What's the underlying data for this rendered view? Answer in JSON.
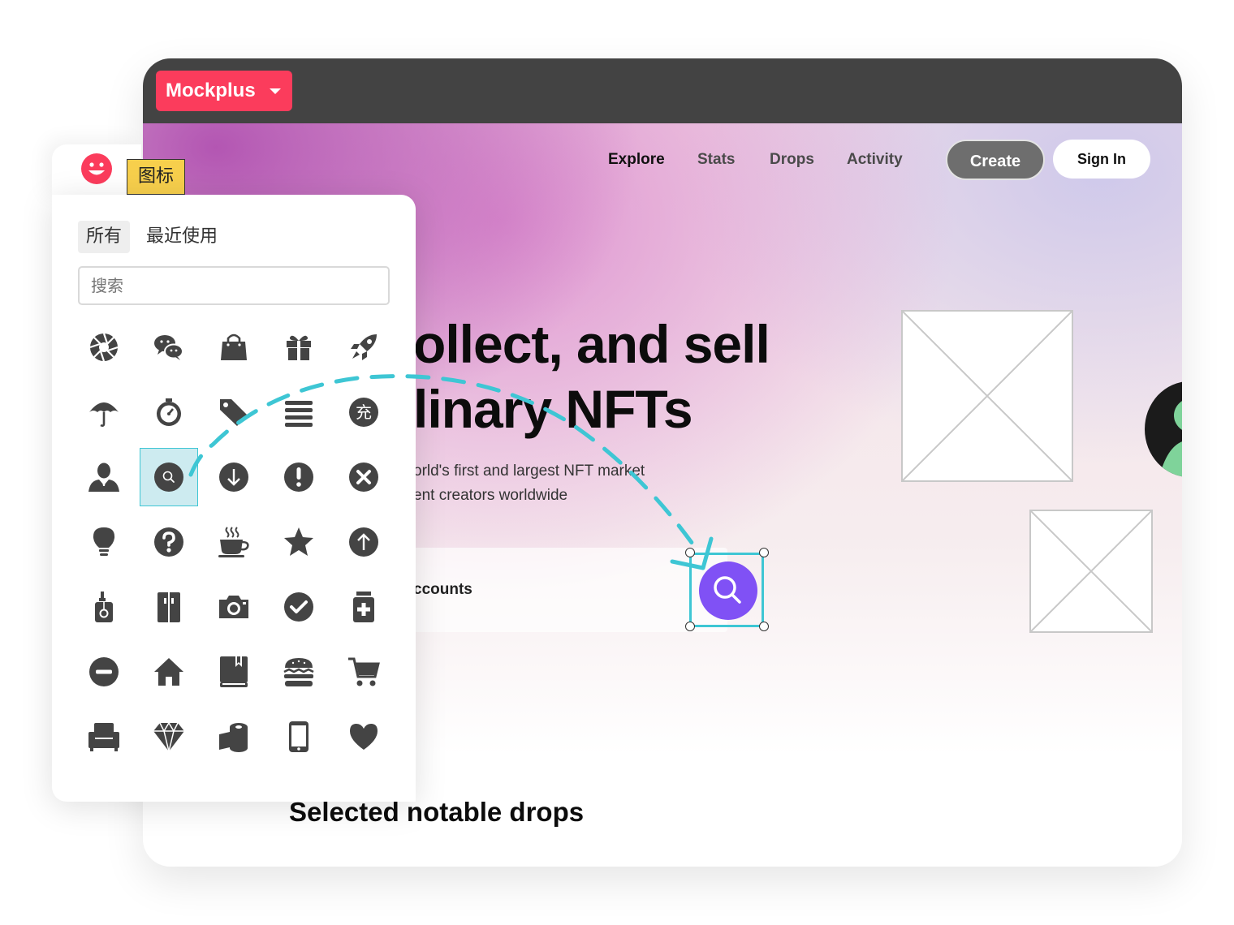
{
  "app": {
    "brand_label": "Mockplus"
  },
  "site": {
    "nav": [
      "Explore",
      "Stats",
      "Drops",
      "Activity"
    ],
    "create_label": "Create",
    "signin_label": "Sign In",
    "hero_title_line1": "ollect, and sell",
    "hero_title_line2": "linary NFTs",
    "hero_sub_line1": "orld's first and largest NFT market",
    "hero_sub_line2": "ent creators worldwide",
    "search_text": "ccounts",
    "section_title": "Selected notable drops"
  },
  "icon_panel": {
    "tag_label": "图标",
    "tabs": [
      "所有",
      "最近使用"
    ],
    "search_placeholder": "搜索",
    "charge_glyph": "充",
    "icons": [
      "aperture-icon",
      "wechat-icon",
      "shopping-bag-icon",
      "gift-icon",
      "rocket-icon",
      "umbrella-icon",
      "stopwatch-icon",
      "tag-icon",
      "list-icon",
      "charge-icon",
      "user-icon",
      "search-icon",
      "arrow-down-circle-icon",
      "exclamation-circle-icon",
      "close-circle-icon",
      "lightbulb-icon",
      "question-circle-icon",
      "coffee-icon",
      "star-icon",
      "arrow-up-circle-icon",
      "bottle-icon",
      "fridge-icon",
      "camera-icon",
      "check-circle-icon",
      "medicine-icon",
      "minus-circle-icon",
      "home-icon",
      "book-icon",
      "burger-icon",
      "cart-icon",
      "armchair-icon",
      "diamond-icon",
      "toilet-roll-icon",
      "phone-icon",
      "heart-icon"
    ],
    "selected_icon": "search-icon"
  },
  "colors": {
    "brand": "#fb3c5c",
    "accent": "#8051f5",
    "selection": "#3ec6d4",
    "tag": "#f7cf4c",
    "icon": "#444444"
  }
}
